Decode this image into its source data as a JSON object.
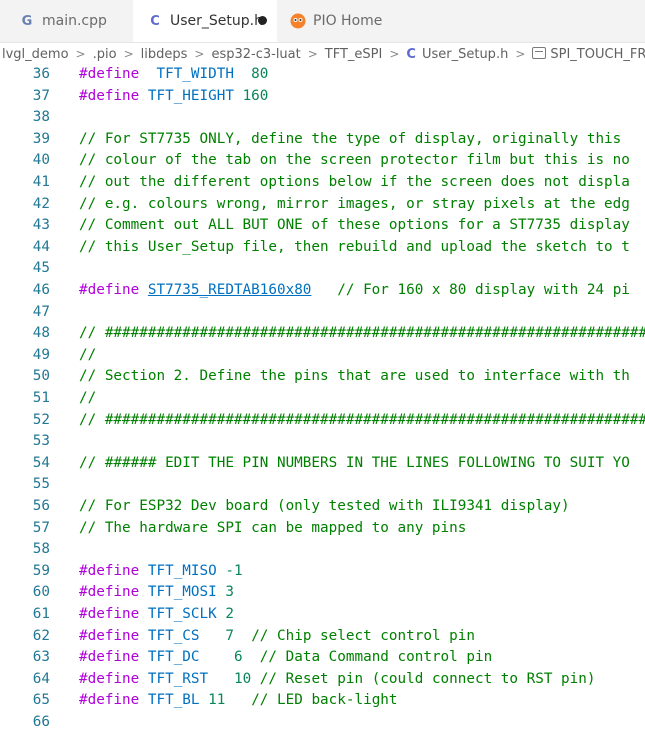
{
  "tabs": [
    {
      "label": "main.cpp",
      "icon": "cpp-file-icon"
    },
    {
      "label": "User_Setup.h",
      "icon": "c-file-icon"
    },
    {
      "label": "PIO Home",
      "icon": "platformio-icon"
    }
  ],
  "breadcrumb": {
    "items": [
      "lvgl_demo",
      ".pio",
      "libdeps",
      "esp32-c3-luat",
      "TFT_eSPI",
      "User_Setup.h",
      "SPI_TOUCH_FREQUE"
    ]
  },
  "lines": [
    {
      "n": "36",
      "t": [
        [
          "kw",
          "#define"
        ],
        [
          "",
          "  "
        ],
        [
          "mac",
          "TFT_WIDTH"
        ],
        [
          "",
          "  "
        ],
        [
          "num",
          "80"
        ]
      ]
    },
    {
      "n": "37",
      "t": [
        [
          "kw",
          "#define"
        ],
        [
          "",
          " "
        ],
        [
          "mac",
          "TFT_HEIGHT"
        ],
        [
          "",
          " "
        ],
        [
          "num",
          "160"
        ]
      ]
    },
    {
      "n": "38",
      "t": []
    },
    {
      "n": "39",
      "t": [
        [
          "com",
          "// For ST7735 ONLY, define the type of display, originally this"
        ]
      ]
    },
    {
      "n": "40",
      "t": [
        [
          "com",
          "// colour of the tab on the screen protector film but this is no"
        ]
      ]
    },
    {
      "n": "41",
      "t": [
        [
          "com",
          "// out the different options below if the screen does not displa"
        ]
      ]
    },
    {
      "n": "42",
      "t": [
        [
          "com",
          "// e.g. colours wrong, mirror images, or stray pixels at the edg"
        ]
      ]
    },
    {
      "n": "43",
      "t": [
        [
          "com",
          "// Comment out ALL BUT ONE of these options for a ST7735 display"
        ]
      ]
    },
    {
      "n": "44",
      "t": [
        [
          "com",
          "// this User_Setup file, then rebuild and upload the sketch to t"
        ]
      ]
    },
    {
      "n": "45",
      "t": []
    },
    {
      "n": "46",
      "t": [
        [
          "kw",
          "#define"
        ],
        [
          "",
          " "
        ],
        [
          "mac und",
          "ST7735_REDTAB160x80"
        ],
        [
          "",
          "   "
        ],
        [
          "com",
          "// For 160 x 80 display with 24 pi"
        ]
      ]
    },
    {
      "n": "47",
      "t": []
    },
    {
      "n": "48",
      "t": [
        [
          "com",
          "// ##################################################################"
        ]
      ]
    },
    {
      "n": "49",
      "t": [
        [
          "com",
          "//"
        ]
      ]
    },
    {
      "n": "50",
      "t": [
        [
          "com",
          "// Section 2. Define the pins that are used to interface with th"
        ]
      ]
    },
    {
      "n": "51",
      "t": [
        [
          "com",
          "//"
        ]
      ]
    },
    {
      "n": "52",
      "t": [
        [
          "com",
          "// ##################################################################"
        ]
      ]
    },
    {
      "n": "53",
      "t": []
    },
    {
      "n": "54",
      "t": [
        [
          "com",
          "// ###### EDIT THE PIN NUMBERS IN THE LINES FOLLOWING TO SUIT YO"
        ]
      ]
    },
    {
      "n": "55",
      "t": []
    },
    {
      "n": "56",
      "t": [
        [
          "com",
          "// For ESP32 Dev board (only tested with ILI9341 display)"
        ]
      ]
    },
    {
      "n": "57",
      "t": [
        [
          "com",
          "// The hardware SPI can be mapped to any pins"
        ]
      ]
    },
    {
      "n": "58",
      "t": []
    },
    {
      "n": "59",
      "t": [
        [
          "kw",
          "#define"
        ],
        [
          "",
          " "
        ],
        [
          "mac",
          "TFT_MISO"
        ],
        [
          "",
          " "
        ],
        [
          "num",
          "-1"
        ]
      ]
    },
    {
      "n": "60",
      "t": [
        [
          "kw",
          "#define"
        ],
        [
          "",
          " "
        ],
        [
          "mac",
          "TFT_MOSI"
        ],
        [
          "",
          " "
        ],
        [
          "num",
          "3"
        ]
      ]
    },
    {
      "n": "61",
      "t": [
        [
          "kw",
          "#define"
        ],
        [
          "",
          " "
        ],
        [
          "mac",
          "TFT_SCLK"
        ],
        [
          "",
          " "
        ],
        [
          "num",
          "2"
        ]
      ]
    },
    {
      "n": "62",
      "t": [
        [
          "kw",
          "#define"
        ],
        [
          "",
          " "
        ],
        [
          "mac",
          "TFT_CS"
        ],
        [
          "",
          "   "
        ],
        [
          "num",
          "7"
        ],
        [
          "",
          "  "
        ],
        [
          "com",
          "// Chip select control pin"
        ]
      ]
    },
    {
      "n": "63",
      "t": [
        [
          "kw",
          "#define"
        ],
        [
          "",
          " "
        ],
        [
          "mac",
          "TFT_DC"
        ],
        [
          "",
          "    "
        ],
        [
          "num",
          "6"
        ],
        [
          "",
          "  "
        ],
        [
          "com",
          "// Data Command control pin"
        ]
      ]
    },
    {
      "n": "64",
      "t": [
        [
          "kw",
          "#define"
        ],
        [
          "",
          " "
        ],
        [
          "mac",
          "TFT_RST"
        ],
        [
          "",
          "   "
        ],
        [
          "num",
          "10"
        ],
        [
          "",
          " "
        ],
        [
          "com",
          "// Reset pin (could connect to RST pin)"
        ]
      ]
    },
    {
      "n": "65",
      "t": [
        [
          "kw",
          "#define"
        ],
        [
          "",
          " "
        ],
        [
          "mac",
          "TFT_BL"
        ],
        [
          "",
          " "
        ],
        [
          "num",
          "11"
        ],
        [
          "",
          "   "
        ],
        [
          "com",
          "// LED back-light"
        ]
      ]
    },
    {
      "n": "66",
      "t": []
    }
  ],
  "colors": {
    "line_number": "#237893",
    "keyword": "#af00db",
    "macro": "#0070c1",
    "number": "#098658",
    "comment": "#008000"
  }
}
